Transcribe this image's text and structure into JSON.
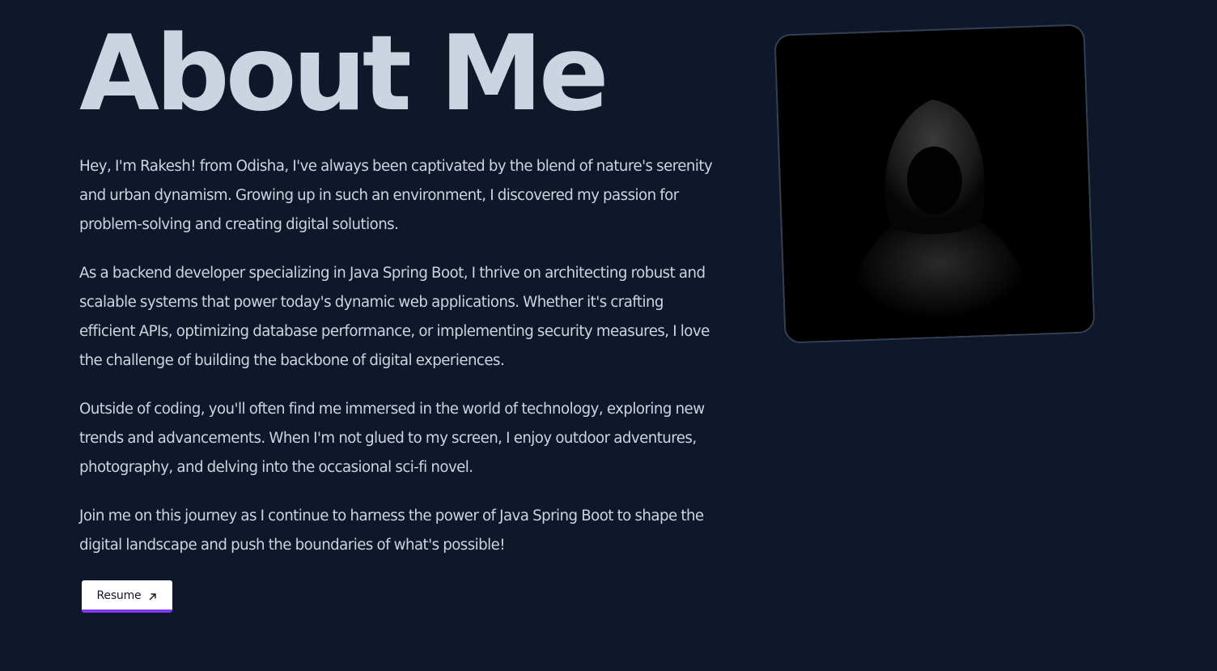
{
  "about": {
    "title": "About Me",
    "paragraphs": [
      "Hey, I'm Rakesh! from Odisha, I've always been captivated by the blend of nature's serenity and urban dynamism. Growing up in such an environment, I discovered my passion for problem-solving and creating digital solutions.",
      "As a backend developer specializing in Java Spring Boot, I thrive on architecting robust and scalable systems that power today's dynamic web applications. Whether it's crafting efficient APIs, optimizing database performance, or implementing security measures, I love the challenge of building the backbone of digital experiences.",
      "Outside of coding, you'll often find me immersed in the world of technology, exploring new trends and advancements. When I'm not glued to my screen, I enjoy outdoor adventures, photography, and delving into the occasional sci-fi novel.",
      "Join me on this journey as I continue to harness the power of Java Spring Boot to shape the digital landscape and push the boundaries of what's possible!"
    ],
    "resume_button": {
      "label": "Resume",
      "icon": "arrow-up-right-icon"
    }
  },
  "profile_image": {
    "subject": "hooded-figure-silhouette"
  },
  "colors": {
    "background": "#0f172a",
    "text": "#cbd5e1",
    "button_bg": "#ffffff",
    "button_accent": "#7c3aed",
    "photo_border": "#334155"
  }
}
